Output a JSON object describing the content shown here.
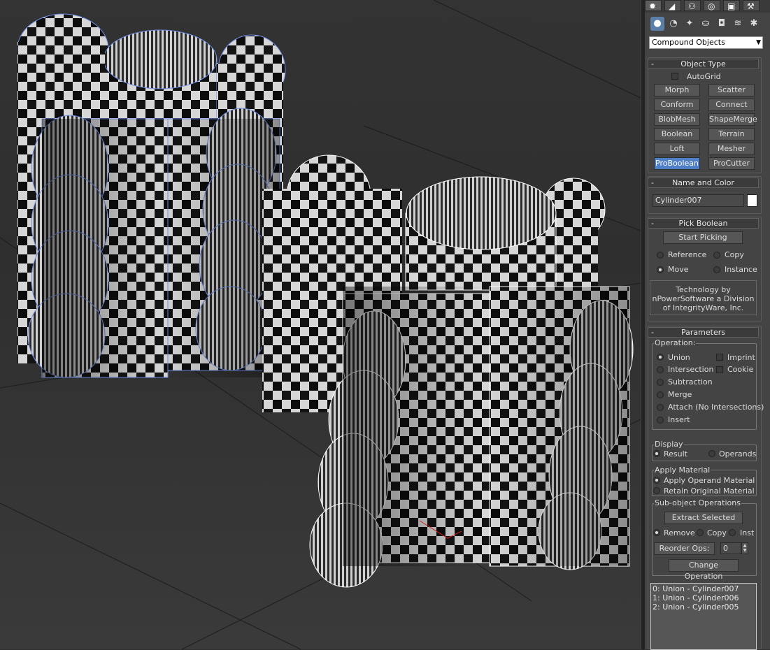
{
  "command_panel": {
    "tab_icons": [
      "create-icon",
      "modify-icon",
      "hierarchy-icon",
      "motion-icon",
      "display-icon",
      "utilities-icon"
    ],
    "subcategory_icons": [
      "geometry-icon",
      "shapes-icon",
      "lights-icon",
      "cameras-icon",
      "helpers-icon",
      "spacewarps-icon",
      "systems-icon"
    ],
    "category_dropdown": "Compound Objects",
    "object_type": {
      "title": "Object Type",
      "autogrid_label": "AutoGrid",
      "buttons": [
        "Morph",
        "Scatter",
        "Conform",
        "Connect",
        "BlobMesh",
        "ShapeMerge",
        "Boolean",
        "Terrain",
        "Loft",
        "Mesher",
        "ProBoolean",
        "ProCutter"
      ],
      "selected": "ProBoolean"
    },
    "name_and_color": {
      "title": "Name and Color",
      "name": "Cylinder007",
      "color": "#ffffff"
    },
    "pick_boolean": {
      "title": "Pick Boolean",
      "start_picking": "Start Picking",
      "reference": "Reference",
      "copy": "Copy",
      "move": "Move",
      "instance": "Instance",
      "info_line1": "Technology by",
      "info_line2": "nPowerSoftware a Division",
      "info_line3": "of IntegrityWare, Inc."
    },
    "parameters": {
      "title": "Parameters",
      "operation_label": "Operation:",
      "union": "Union",
      "intersection": "Intersection",
      "subtraction": "Subtraction",
      "merge": "Merge",
      "attach": "Attach (No Intersections)",
      "insert": "Insert",
      "imprint": "Imprint",
      "cookie": "Cookie",
      "display_label": "Display",
      "result": "Result",
      "operands": "Operands",
      "apply_material_label": "Apply Material",
      "apply_operand_material": "Apply Operand Material",
      "retain_original_material": "Retain Original Material",
      "subobject_label": "Sub-object Operations",
      "extract_selected": "Extract Selected",
      "remove": "Remove",
      "copy": "Copy",
      "inst": "Inst",
      "reorder_ops": "Reorder Ops:",
      "reorder_value": "0",
      "change_operation": "Change Operation"
    },
    "operations_list": [
      "0: Union - Cylinder007",
      "1: Union - Cylinder006",
      "2: Union - Cylinder005"
    ]
  }
}
